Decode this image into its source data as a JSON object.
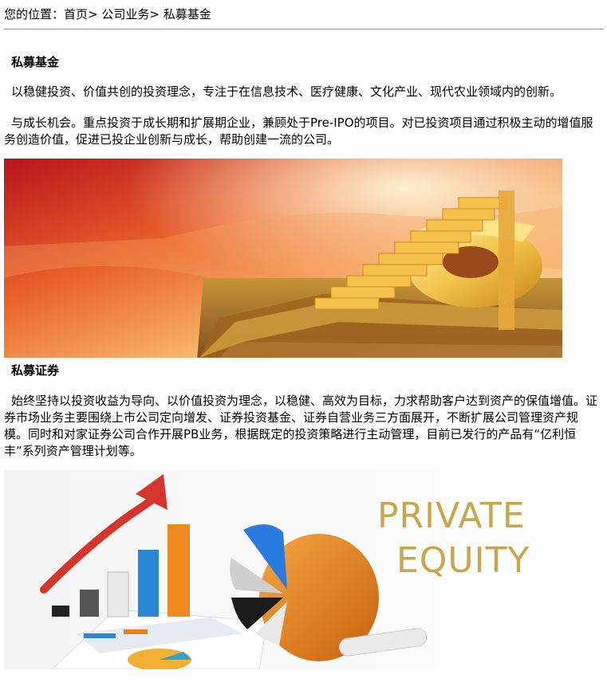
{
  "breadcrumb": {
    "prefix": "您的位置：",
    "items": [
      {
        "label": "首页",
        "sep": ">"
      },
      {
        "label": "公司业务",
        "sep": ">"
      },
      {
        "label": "私募基金",
        "sep": ""
      }
    ]
  },
  "section1": {
    "title": "私募基金",
    "para1": "以稳健投资、价值共创的投资理念，专注于在信息技术、医疗健康、文化产业、现代农业领域内的创新。",
    "para2": "与成长机会。重点投资于成长期和扩展期企业，兼顾处于Pre-IPO的项目。对已投资项目通过积极主动的增值服务创造价值，促进已投企业创新与成长，帮助创建一流的公司。",
    "image_icon": "golden-dollar-staircase-image"
  },
  "section2": {
    "title": "私募证券",
    "para": "始终坚持以投资收益为导向、以价值投资为理念，以稳健、高效为目标，力求帮助客户达到资产的保值增值。证券市场业务主要围绕上市公司定向增发、证券投资基金、证券自营业务三方面展开，不断扩展公司管理资产规模。同时和对家证券公司合作开展PB业务，根据既定的投资策略进行主动管理，目前已发行的产品有“亿利恒丰”系列资产管理计划等。",
    "image_icon": "private-equity-chart-image",
    "image_text_line1": "PRIVATE",
    "image_text_line2": "EQUITY"
  },
  "colors": {
    "rule": "#9a9a9a",
    "sunset": "#e8602a",
    "gold": "#f3c44a",
    "arrow_red": "#d8352a",
    "pe_text": "#c9a64a",
    "pie_orange": "#e5841e"
  }
}
